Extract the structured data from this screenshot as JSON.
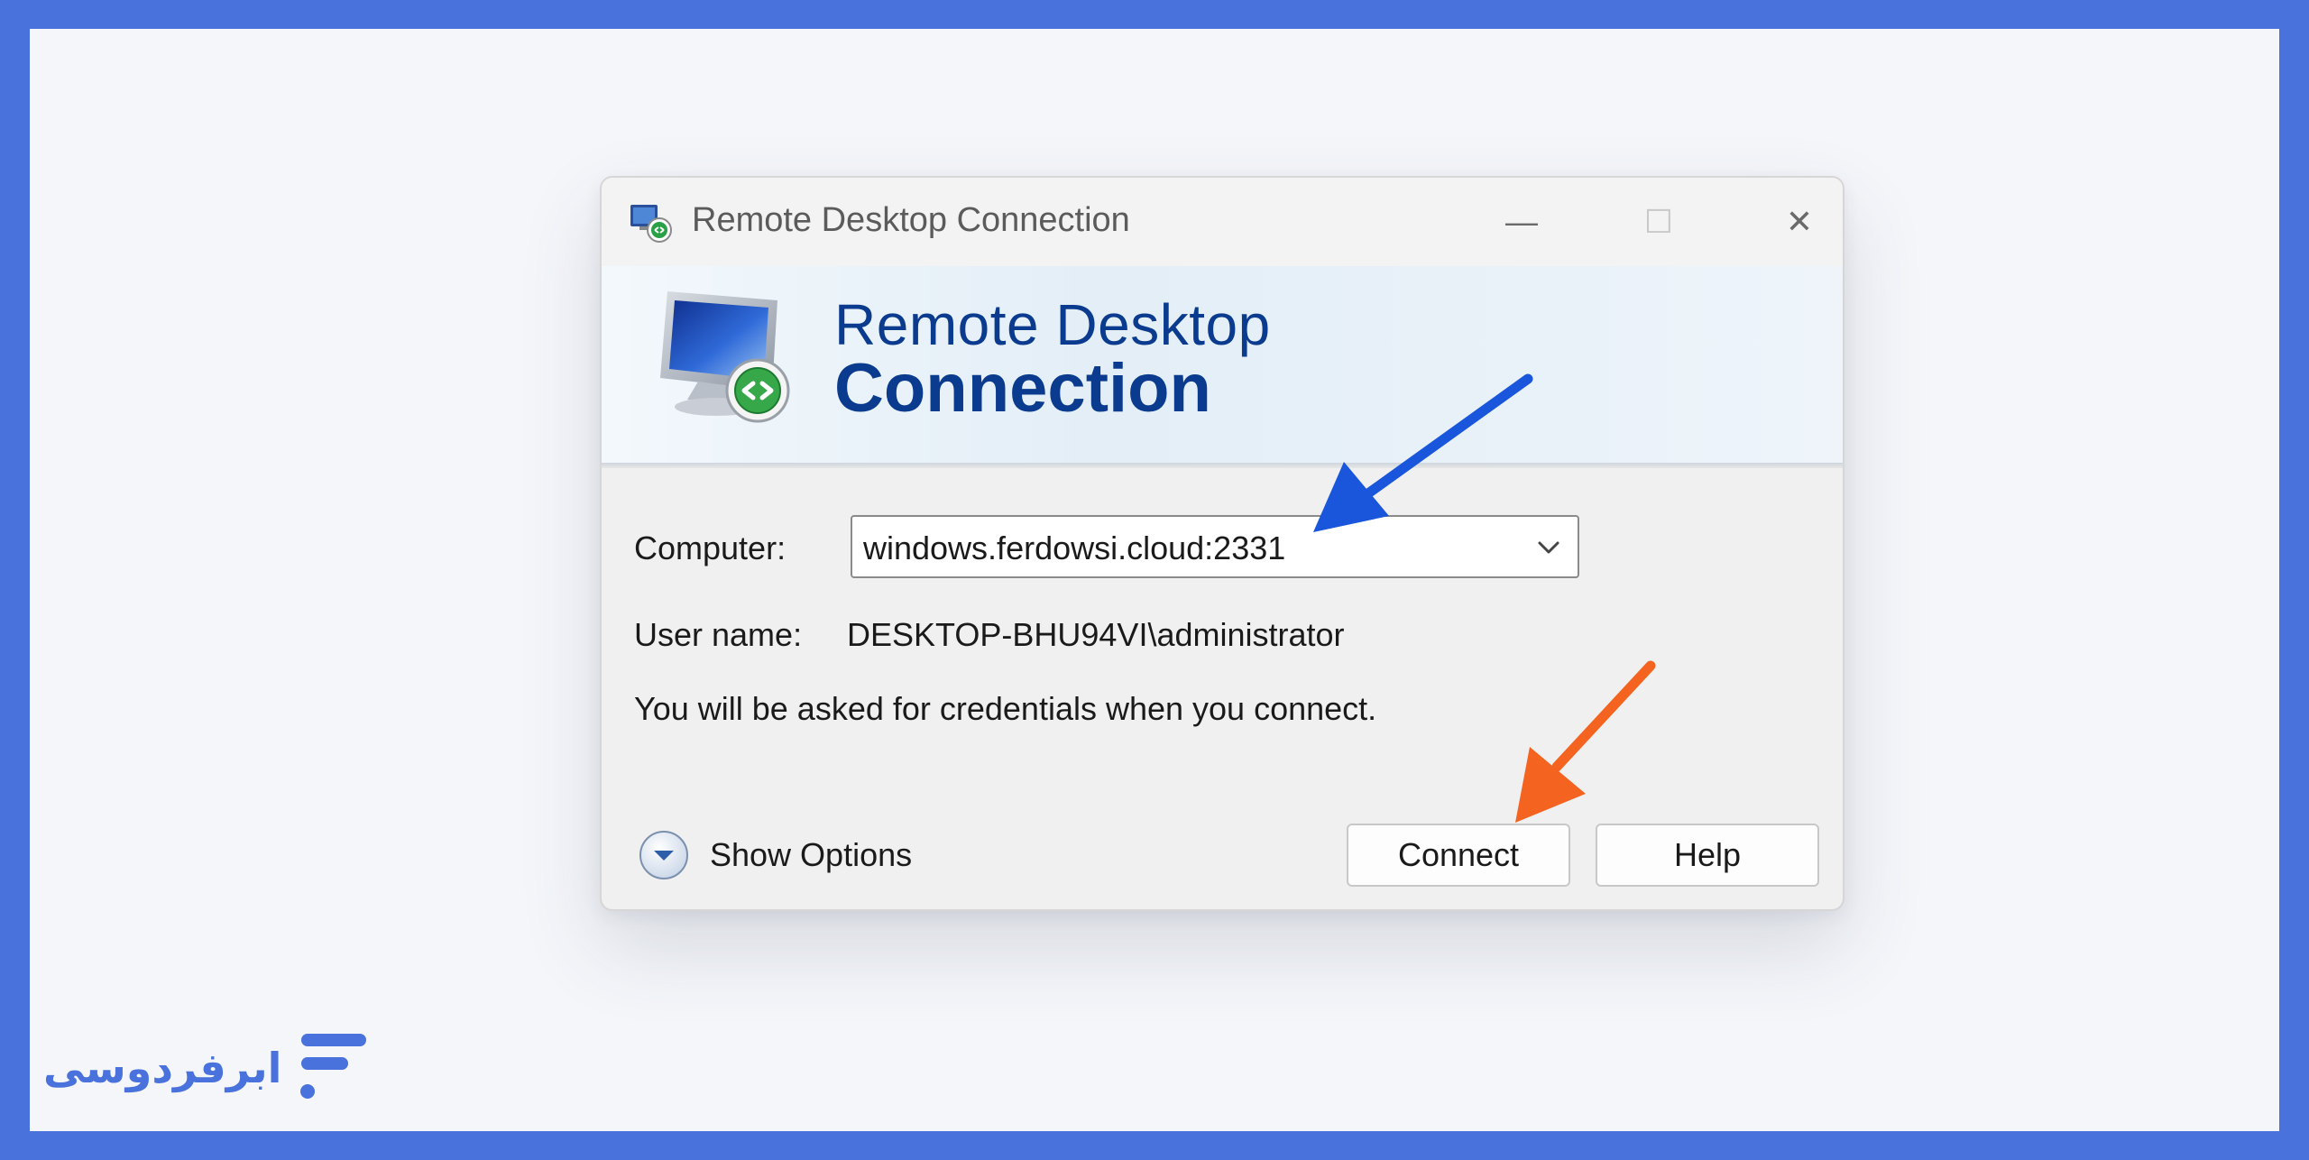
{
  "window": {
    "title": "Remote Desktop Connection",
    "min_glyph": "—",
    "max_glyph": "☐",
    "close_glyph": "✕"
  },
  "banner": {
    "line1": "Remote Desktop",
    "line2": "Connection"
  },
  "form": {
    "computer_label": "Computer:",
    "computer_value": "windows.ferdowsi.cloud:2331",
    "username_label": "User name:",
    "username_value": "DESKTOP-BHU94VI\\administrator",
    "info": "You will be asked for credentials when you connect."
  },
  "footer": {
    "show_options": "Show Options",
    "connect": "Connect",
    "help": "Help"
  },
  "brand": {
    "name": "ابرفردوسی"
  },
  "colors": {
    "frame": "#4a72dd",
    "banner_text": "#0a3b8e",
    "arrow_blue": "#1a56db",
    "arrow_orange": "#f4631f"
  }
}
